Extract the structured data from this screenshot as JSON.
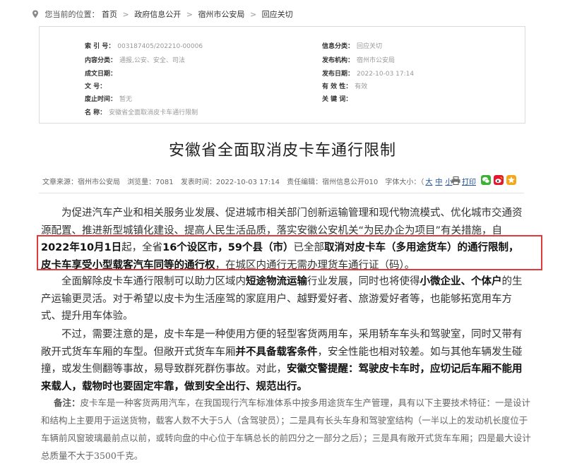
{
  "breadcrumb": {
    "prefix": "您当前的位置：",
    "items": [
      "首页",
      "政府信息公开",
      "宿州市公安局",
      "回应关切"
    ],
    "separator": ">"
  },
  "meta": {
    "index_label": "索 引 号：",
    "index_value": "003187405/202210-00006",
    "category_label": "内容分类：",
    "category_value": "通报,公安、安全、司法",
    "date_formed_label": "成文日期：",
    "date_formed_value": "",
    "doc_no_label": "文       号：",
    "doc_no_value": "",
    "abolish_label": "废止时间：",
    "abolish_value": "暂无",
    "name_label": "名       称：",
    "name_value": "安徽省全面取消皮卡车通行限制",
    "source_label": "信息分类：",
    "source_value": "回应关切",
    "publisher_label": "发布机构：",
    "publisher_value": "宿州市公安局",
    "pubdate_label": "发布日期：",
    "pubdate_value": "2022-10-03 17:14",
    "validity_label": "有 效 性：",
    "validity_value": "有效",
    "keywords_label": "关 键 词：",
    "keywords_value": ""
  },
  "article": {
    "title": "安徽省全面取消皮卡车通行限制",
    "source": "文章来源：宿州市公安局",
    "views": "浏览量：7081",
    "published": "发表时间：2022-10-03 17:14",
    "editor": "责任编辑：宿州信息公开010",
    "font_size_label": "字体大小：（",
    "size_large": "大",
    "size_medium": "中",
    "size_small": "小",
    "font_size_close": "）",
    "print_label": "打印",
    "p1_a": "为促进汽车产业和相关服务业发展、促进城市相关部门创新运输管理和现代物流模式、优化城市交通资源配置、推进新型城镇化建设、提高人民生活品质，落实安徽公安机关“为民办企为项目”有关措施，自",
    "p1_b": "2022年10月1日",
    "p1_c": "起，全省",
    "p1_d": "16个设区市，59个县（市）",
    "p1_e": "已全部",
    "p1_f": "取消对皮卡车（多用途货车）的通行限制，皮卡车享受小型载客汽车同等的通行权",
    "p1_g": "，在城区内通行无需办理货车通行证（码）。",
    "p2_a": "全面解除皮卡车通行限制可以助力区域内",
    "p2_b": "短途物流运输",
    "p2_c": "行业发展，同时也将使得",
    "p2_d": "小微企业、个体户",
    "p2_e": "的生产运输更灵活。对于希望以皮卡为生活座驾的家庭用户、越野爱好者、旅游爱好者等，也能够拓宽用车方式、提升用车体验。",
    "p3_a": "不过，需要注意的是，皮卡车是一种使用方便的轻型客货两用车，采用轿车车头和驾驶室，同时又带有敞开式货车车厢的车型。但敞开式货车车厢",
    "p3_b": "并不具备载客条件",
    "p3_c": "，安全性能也相对较差。如与其他车辆发生碰撞，或发生侧翻等事故，易导致群死群伤事故。对此，",
    "p3_d": "安徽交警提醒：驾驶皮卡车时，应切记后车厢不能用来载人，载物时也要固定牢靠，做到安全出行、规范出行。",
    "note_label": "备注：",
    "note_text": "皮卡车是一种客货两用汽车，在我国现行汽车标准体系中按多用途货车生产管理，具有以下主要技术特征：一是设计和结构上主要用于运送货物，载客人数不大于5人（含驾驶员）；二是具有长头车身和驾驶室结构（一半以上的发动机长度位于车辆前风窗玻璃最前点以前，或转向盘的中心位于车辆总长的前四分之一部分之后）；三是具有敞开式货车车厢；四是最大设计总质量不大于3500千克。"
  },
  "colors": {
    "highlight_border": "#e03a3a",
    "link": "#1a4fa0",
    "wechat": "#3cb034",
    "weibo": "#e6162d",
    "star": "#f3a81c"
  },
  "icons": [
    "location-icon",
    "print-icon",
    "wechat-icon",
    "weibo-icon",
    "favorite-icon"
  ]
}
